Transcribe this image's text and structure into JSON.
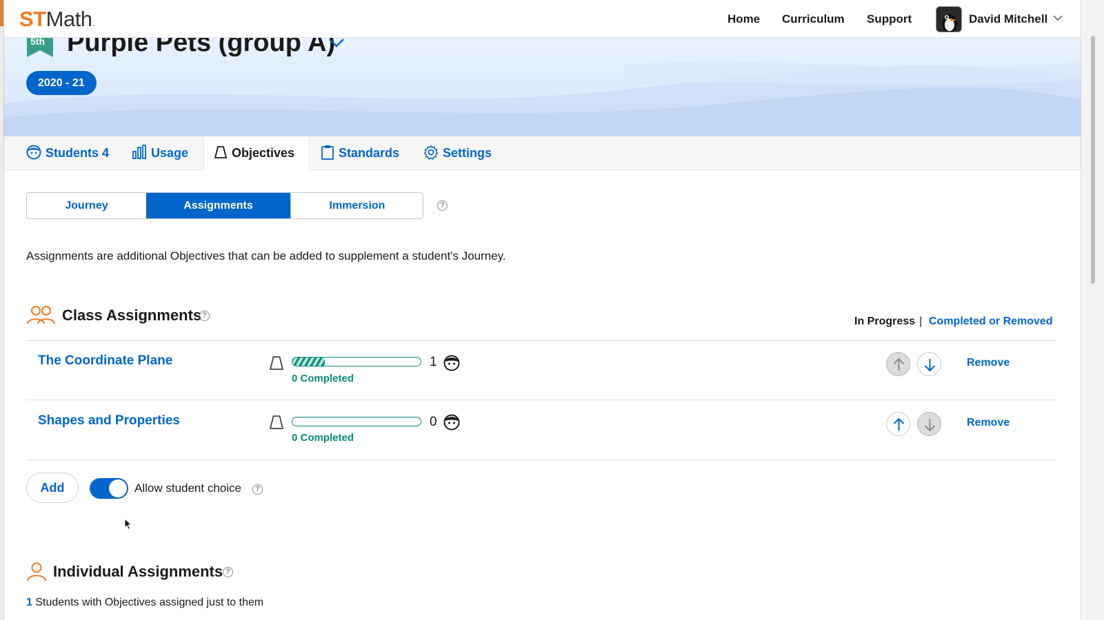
{
  "app": {
    "logo_st": "ST",
    "logo_math": "Math",
    "logo_mark": "."
  },
  "topnav": {
    "links": [
      "Home",
      "Curriculum",
      "Support"
    ],
    "user_name": "David Mitchell"
  },
  "banner": {
    "grade": "5th",
    "class_name": "Purple Pets (group A)",
    "year": "2020 - 21"
  },
  "tabs": {
    "students_label": "Students",
    "students_count": "4",
    "usage_label": "Usage",
    "objectives_label": "Objectives",
    "standards_label": "Standards",
    "settings_label": "Settings"
  },
  "subtabs": {
    "journey": "Journey",
    "assignments": "Assignments",
    "immersion": "Immersion",
    "help": "?"
  },
  "description": "Assignments are additional Objectives that can be added to supplement a student's Journey.",
  "class_assignments": {
    "title": "Class Assignments",
    "filter_active": "In Progress",
    "filter_sep": "|",
    "filter_other": "Completed or Removed",
    "rows": [
      {
        "name": "The Coordinate Plane",
        "count": "1",
        "completed": "0 Completed",
        "progress": 0.25,
        "remove": "Remove"
      },
      {
        "name": "Shapes and Properties",
        "count": "0",
        "completed": "0 Completed",
        "progress": 0,
        "remove": "Remove"
      }
    ],
    "add_label": "Add",
    "allow_choice_label": "Allow student choice",
    "allow_choice_on": true
  },
  "individual_assignments": {
    "title": "Individual Assignments",
    "count": "1",
    "subtitle": "Students with Objectives assigned just to them"
  },
  "colors": {
    "brand_blue": "#0066cc",
    "logo_orange": "#f07c21",
    "teal": "#0a8a7a"
  }
}
